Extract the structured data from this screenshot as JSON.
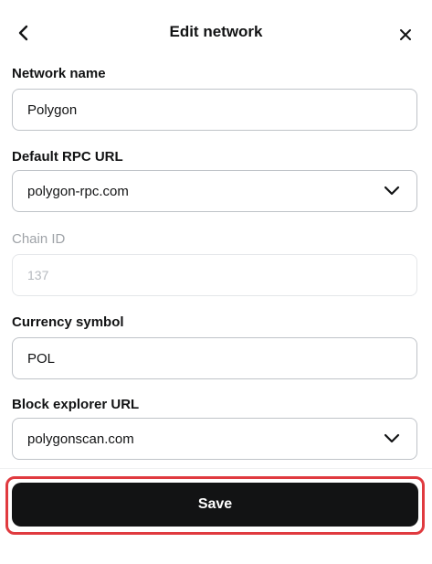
{
  "header": {
    "title": "Edit network",
    "back_icon": "chevron-left-icon",
    "close_icon": "close-icon"
  },
  "fields": {
    "network_name": {
      "label": "Network name",
      "value": "Polygon"
    },
    "rpc_url": {
      "label": "Default RPC URL",
      "value": "polygon-rpc.com"
    },
    "chain_id": {
      "label": "Chain ID",
      "value": "137"
    },
    "currency_symbol": {
      "label": "Currency symbol",
      "value": "POL"
    },
    "explorer_url": {
      "label": "Block explorer URL",
      "value": "polygonscan.com"
    }
  },
  "footer": {
    "save_label": "Save"
  },
  "colors": {
    "primary_button": "#121314",
    "highlight": "#e03a3f",
    "border": "#bfc3c8",
    "muted_text": "#9fa3a8"
  }
}
